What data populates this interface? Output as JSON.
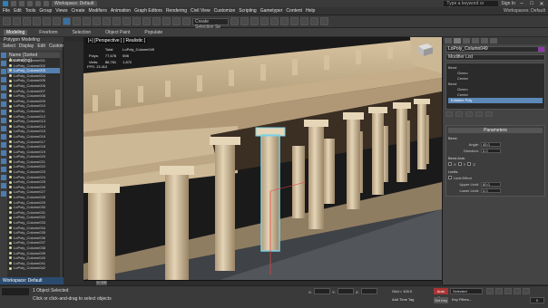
{
  "window": {
    "workspace": "Workspace: Default",
    "search_placeholder": "Type a keyword or phrase",
    "user": "Sign In"
  },
  "menu": {
    "items": [
      "File",
      "Edit",
      "Tools",
      "Group",
      "Views",
      "Create",
      "Modifiers",
      "Animation",
      "Graph Editors",
      "Rendering",
      "Civil View",
      "Customize",
      "Scripting",
      "Gametyper",
      "Content",
      "Help"
    ],
    "right_label": "Workspaces: Default"
  },
  "toolbar": {
    "selection_set": "Create Selection Se"
  },
  "ribbon": {
    "tabs": [
      "Modeling",
      "Freeform",
      "Selection",
      "Object Paint",
      "Populate"
    ],
    "active": "Modeling",
    "sub_label": "Polygon Modeling"
  },
  "explorer": {
    "tabs": [
      "Select",
      "Display",
      "Edit",
      "Customize"
    ],
    "header": "Name (Sorted Ascending)",
    "items": [
      "LoPoly_Column001",
      "LoPoly_Column002",
      "LoPoly_Column003",
      "LoPoly_Column004",
      "LoPoly_Column005",
      "LoPoly_Column006",
      "LoPoly_Column007",
      "LoPoly_Column008",
      "LoPoly_Column009",
      "LoPoly_Column010",
      "LoPoly_Column011",
      "LoPoly_Column012",
      "LoPoly_Column013",
      "LoPoly_Column014",
      "LoPoly_Column015",
      "LoPoly_Column016",
      "LoPoly_Column017",
      "LoPoly_Column018",
      "LoPoly_Column019",
      "LoPoly_Column020",
      "LoPoly_Column021",
      "LoPoly_Column022",
      "LoPoly_Column023",
      "LoPoly_Column024",
      "LoPoly_Column025",
      "LoPoly_Column026",
      "LoPoly_Column027",
      "LoPoly_Column028",
      "LoPoly_Column029",
      "LoPoly_Column030",
      "LoPoly_Column031",
      "LoPoly_Column032",
      "LoPoly_Column033",
      "LoPoly_Column034",
      "LoPoly_Column035",
      "LoPoly_Column036",
      "LoPoly_Column037",
      "LoPoly_Column038",
      "LoPoly_Column039",
      "LoPoly_Column040",
      "LoPoly_Column041",
      "LoPoly_Column042"
    ],
    "selected_index": 2,
    "bottom_label": "Workspace: Default"
  },
  "viewport": {
    "label": "[+] [Perspective ] [ Realistic ]",
    "stats": {
      "header_total": "Total",
      "header_obj": "LoPoly_Column049",
      "polys_label": "Polys:",
      "polys_total": "77,678",
      "polys_obj": "598",
      "verts_label": "Verts:",
      "verts_total": "86,761",
      "verts_obj": "1,872"
    },
    "fps_label": "FPS:",
    "fps_value": "13.412"
  },
  "command_panel": {
    "object_name": "LoPoly_Column049",
    "object_color": "#8a3aa8",
    "modifier_list": "Modifier List",
    "stack": [
      {
        "label": "Bend",
        "indent": false,
        "highlight": false
      },
      {
        "label": "Gizmo",
        "indent": true,
        "highlight": false
      },
      {
        "label": "Center",
        "indent": true,
        "highlight": false
      },
      {
        "label": "Bend",
        "indent": false,
        "highlight": false
      },
      {
        "label": "Gizmo",
        "indent": true,
        "highlight": false
      },
      {
        "label": "Center",
        "indent": true,
        "highlight": false
      },
      {
        "label": "Editable Poly",
        "indent": false,
        "highlight": true
      }
    ],
    "params_title": "Parameters",
    "bend_label": "Bend:",
    "angle_label": "Angle:",
    "angle_value": "45.0",
    "direction_label": "Direction:",
    "direction_value": "0.0",
    "bend_axis_label": "Bend Axis:",
    "axes": [
      "X",
      "Y",
      "Z"
    ],
    "limits_label": "Limits",
    "limit_effect": "Limit Effect",
    "upper_label": "Upper Limit:",
    "upper_value": "60.0",
    "lower_label": "Lower Limit:",
    "lower_value": "0.0"
  },
  "timeline": {
    "slider": "0 / 100"
  },
  "status": {
    "main": "1 Object Selected",
    "hint": "Click or click-and-drag to select objects",
    "x_label": "X:",
    "y_label": "Y:",
    "z_label": "Z:",
    "grid": "Grid = 100.0",
    "add_time_tag": "Add Time Tag",
    "auto_key": "Auto Key",
    "selected": "Selected",
    "set_key": "Set Key",
    "key_filters": "Key Filters...",
    "frame": "0"
  }
}
